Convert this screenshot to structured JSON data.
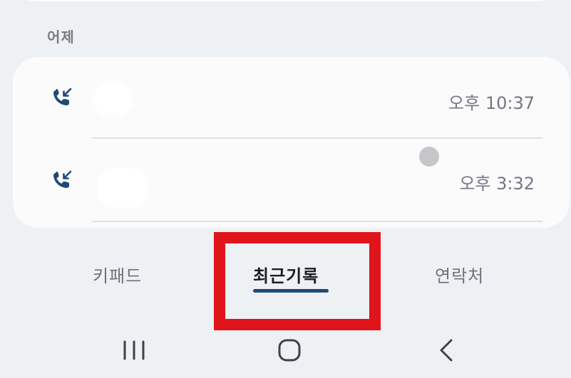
{
  "section": {
    "date_label": "어제"
  },
  "calls": [
    {
      "type": "incoming",
      "icon": "incoming-call-icon",
      "contact_redacted": true,
      "time": "오후 10:37"
    },
    {
      "type": "incoming",
      "icon": "incoming-call-icon",
      "contact_redacted": true,
      "time": "오후 3:32"
    }
  ],
  "tabs": [
    {
      "label": "키패드",
      "selected": false
    },
    {
      "label": "최근기록",
      "selected": true
    },
    {
      "label": "연락처",
      "selected": false
    }
  ],
  "navbar": {
    "buttons": [
      "recent-apps-icon",
      "home-icon",
      "back-icon"
    ]
  },
  "colors": {
    "accent": "#1f4a75",
    "highlight": "#e0141b",
    "background": "#eef1f4",
    "card": "#fbfbfc"
  }
}
